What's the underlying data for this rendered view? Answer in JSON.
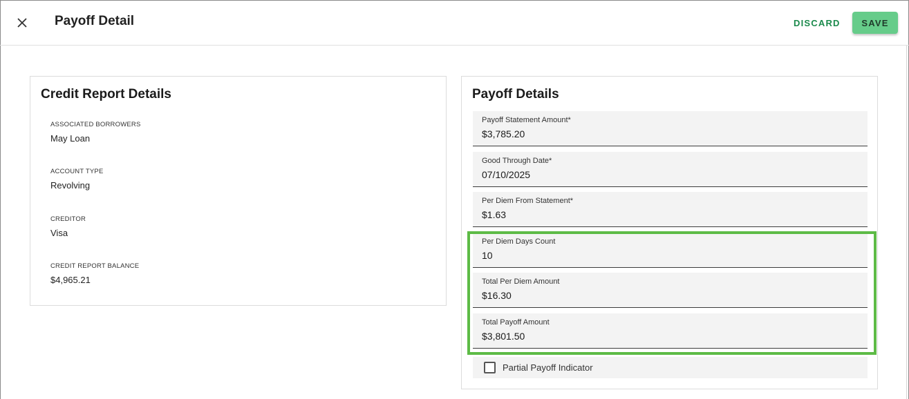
{
  "header": {
    "title": "Payoff Detail",
    "discard_label": "DISCARD",
    "save_label": "SAVE"
  },
  "credit_report": {
    "title": "Credit Report Details",
    "fields": [
      {
        "label": "ASSOCIATED BORROWERS",
        "value": "May Loan"
      },
      {
        "label": "ACCOUNT TYPE",
        "value": "Revolving"
      },
      {
        "label": "CREDITOR",
        "value": "Visa"
      },
      {
        "label": "CREDIT REPORT BALANCE",
        "value": "$4,965.21"
      }
    ]
  },
  "payoff": {
    "title": "Payoff Details",
    "fields": [
      {
        "label": "Payoff Statement Amount*",
        "value": "$3,785.20"
      },
      {
        "label": "Good Through Date*",
        "value": "07/10/2025"
      },
      {
        "label": "Per Diem From Statement*",
        "value": "$1.63"
      },
      {
        "label": "Per Diem Days Count",
        "value": "10"
      },
      {
        "label": "Total Per Diem Amount",
        "value": "$16.30"
      },
      {
        "label": "Total Payoff Amount",
        "value": "$3,801.50"
      }
    ],
    "partial_payoff_label": "Partial Payoff Indicator",
    "partial_payoff_checked": false
  },
  "colors": {
    "accent_green": "#1b8a4c",
    "save_button": "#66cc8a",
    "highlight": "#5dbb46"
  },
  "icons": {
    "close": "close-icon",
    "checkbox": "checkbox-icon"
  }
}
